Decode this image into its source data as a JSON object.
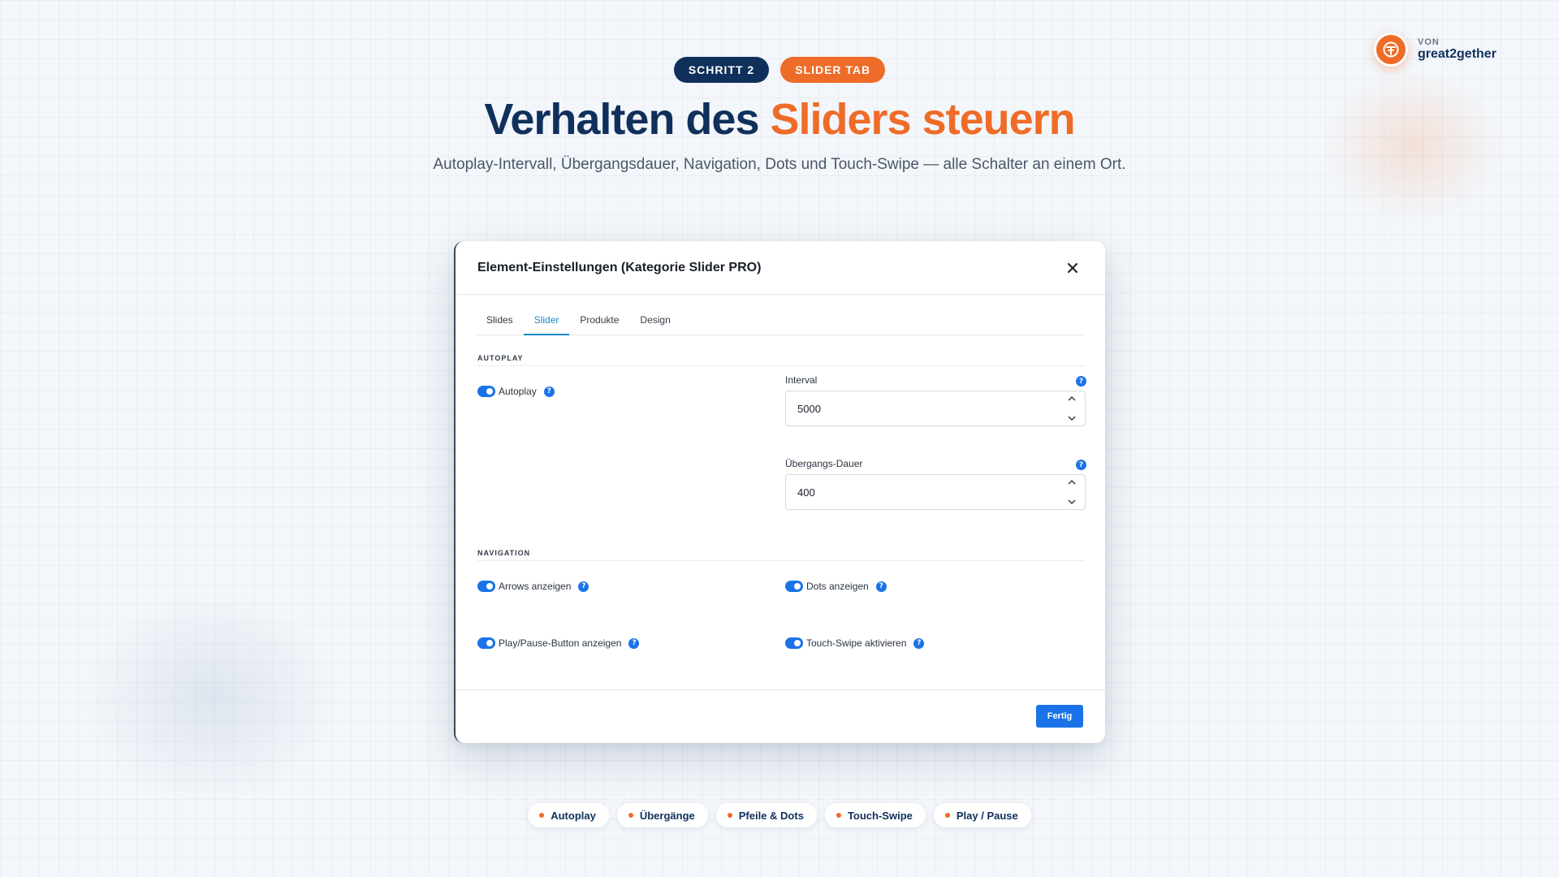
{
  "brand": {
    "prefix": "VON",
    "name": "great2gether"
  },
  "header": {
    "step_badge": "SCHRITT 2",
    "tab_badge": "SLIDER TAB",
    "title_part1": "Verhalten des ",
    "title_part2": "Sliders steuern",
    "subtitle": "Autoplay-Intervall, Übergangsdauer, Navigation, Dots und Touch-Swipe — alle Schalter an einem Ort."
  },
  "dialog": {
    "title": "Element-Einstellungen (Kategorie Slider PRO)",
    "tabs": [
      {
        "label": "Slides",
        "active": false
      },
      {
        "label": "Slider",
        "active": true
      },
      {
        "label": "Produkte",
        "active": false
      },
      {
        "label": "Design",
        "active": false
      }
    ],
    "autoplay": {
      "section_label": "AUTOPLAY",
      "toggle_label": "Autoplay",
      "toggle_on": true,
      "interval_label": "Interval",
      "interval_value": "5000",
      "transition_label": "Übergangs-Dauer",
      "transition_value": "400"
    },
    "navigation": {
      "section_label": "NAVIGATION",
      "arrows_label": "Arrows anzeigen",
      "dots_label": "Dots anzeigen",
      "playpause_label": "Play/Pause-Button anzeigen",
      "touchswipe_label": "Touch-Swipe aktivieren",
      "all_on": true
    },
    "help_glyph": "?",
    "done_label": "Fertig"
  },
  "chips": [
    "Autoplay",
    "Übergänge",
    "Pfeile & Dots",
    "Touch-Swipe",
    "Play / Pause"
  ],
  "colors": {
    "navy": "#10305c",
    "orange": "#ee6c28",
    "primary_blue": "#1a73e8",
    "tab_active": "#1e88c8"
  }
}
